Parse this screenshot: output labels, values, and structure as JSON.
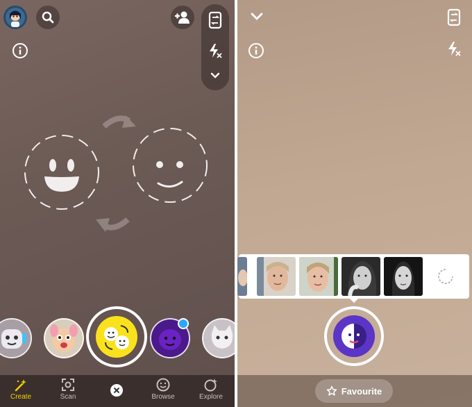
{
  "left_panel": {
    "nav": [
      {
        "id": "create",
        "label": "Create",
        "icon": "create-wand-icon",
        "active": true
      },
      {
        "id": "scan",
        "label": "Scan",
        "icon": "scan-icon",
        "active": false
      },
      {
        "id": "close",
        "label": "",
        "icon": "close-icon",
        "active": false
      },
      {
        "id": "browse",
        "label": "Browse",
        "icon": "browse-smiley-icon",
        "active": false
      },
      {
        "id": "explore",
        "label": "Explore",
        "icon": "explore-icon",
        "active": false
      }
    ]
  },
  "right_panel": {
    "favourite_label": "Favourite"
  },
  "colors": {
    "accent_yellow": "#f5d000",
    "nav_text": "#c9bfbb",
    "purple_lens": "#4b1a8a",
    "notification_dot": "#2aa6ff"
  }
}
